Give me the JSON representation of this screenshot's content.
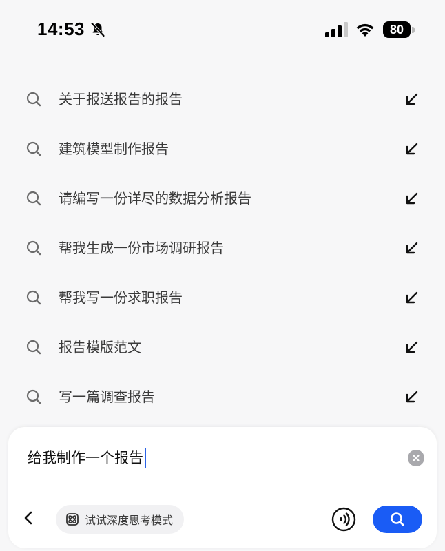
{
  "status_bar": {
    "time": "14:53",
    "battery_level": "80",
    "icons": [
      "bell-slash-icon",
      "cellular-signal-icon",
      "wifi-icon",
      "battery-icon"
    ]
  },
  "suggestions": [
    {
      "label": "关于报送报告的报告"
    },
    {
      "label": "建筑模型制作报告"
    },
    {
      "label": "请编写一份详尽的数据分析报告"
    },
    {
      "label": "帮我生成一份市场调研报告"
    },
    {
      "label": "帮我写一份求职报告"
    },
    {
      "label": "报告模版范文"
    },
    {
      "label": "写一篇调查报告"
    }
  ],
  "input": {
    "value": "给我制作一个报告"
  },
  "toolbar": {
    "deep_think_label": "试试深度思考模式"
  },
  "colors": {
    "accent": "#1a5cf5",
    "caret": "#2b63e6",
    "background": "#f7f7f8"
  }
}
